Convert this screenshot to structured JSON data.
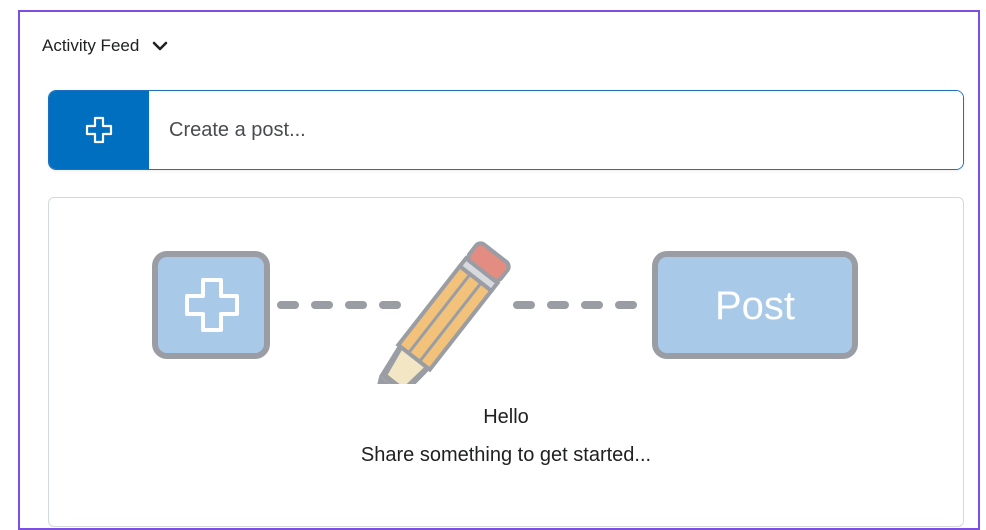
{
  "header": {
    "title": "Activity Feed",
    "toggle_icon": "chevron-down-icon"
  },
  "composer": {
    "add_icon": "plus-outline-icon",
    "placeholder": "Create a post...",
    "accent_color": "#006fbf"
  },
  "empty_state": {
    "illustration": {
      "left_icon": "plus-outline-icon",
      "middle_icon": "pencil-icon",
      "right_button_label": "Post"
    },
    "title": "Hello",
    "subtitle": "Share something to get started..."
  },
  "colors": {
    "frame": "#7b4fe0",
    "illustration_fill": "#a9c9e8",
    "illustration_border": "#9a9ea4"
  }
}
